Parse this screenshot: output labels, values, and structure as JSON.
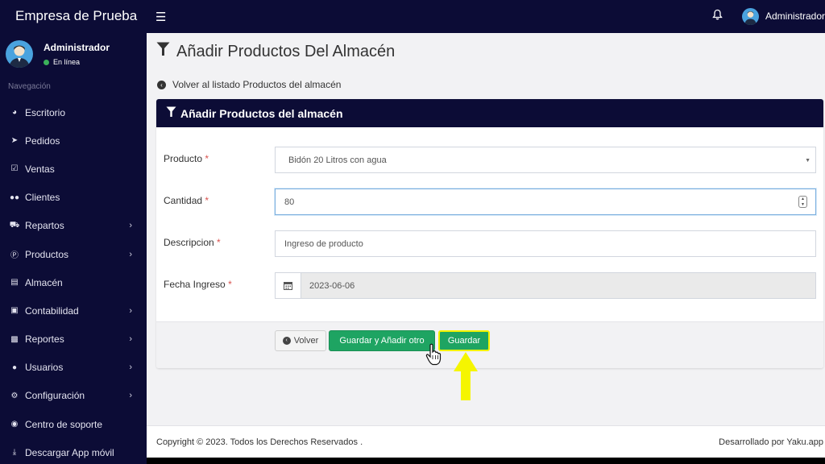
{
  "topbar": {
    "brand": "Empresa de Prueba",
    "user": "Administrador"
  },
  "sidebar": {
    "user_name": "Administrador",
    "status": "En línea",
    "section_header": "Navegación",
    "items": [
      {
        "label": "Escritorio",
        "icon": "dashboard-icon",
        "has_submenu": false
      },
      {
        "label": "Pedidos",
        "icon": "rocket-icon",
        "has_submenu": false
      },
      {
        "label": "Ventas",
        "icon": "check-square-icon",
        "has_submenu": false
      },
      {
        "label": "Clientes",
        "icon": "users-icon",
        "has_submenu": false
      },
      {
        "label": "Repartos",
        "icon": "truck-icon",
        "has_submenu": true
      },
      {
        "label": "Productos",
        "icon": "product-p-icon",
        "has_submenu": true
      },
      {
        "label": "Almacén",
        "icon": "document-icon",
        "has_submenu": false
      },
      {
        "label": "Contabilidad",
        "icon": "money-icon",
        "has_submenu": true
      },
      {
        "label": "Reportes",
        "icon": "bar-chart-icon",
        "has_submenu": true
      },
      {
        "label": "Usuarios",
        "icon": "user-icon",
        "has_submenu": true
      },
      {
        "label": "Configuración",
        "icon": "cogs-icon",
        "has_submenu": true
      },
      {
        "label": "Centro de soporte",
        "icon": "life-ring-icon",
        "has_submenu": false
      },
      {
        "label": "Descargar App móvil",
        "icon": "download-icon",
        "has_submenu": false
      }
    ]
  },
  "page": {
    "title": "Añadir Productos Del Almacén",
    "back_link": "Volver al listado Productos del almacén"
  },
  "form": {
    "header": "Añadir Productos del almacén",
    "fields": {
      "producto": {
        "label": "Producto",
        "required_mark": "*",
        "value": "Bidón 20 Litros con agua"
      },
      "cantidad": {
        "label": "Cantidad",
        "required_mark": "*",
        "value": "80"
      },
      "descripcion": {
        "label": "Descripcion",
        "required_mark": "*",
        "value": "Ingreso de producto"
      },
      "fecha": {
        "label": "Fecha Ingreso",
        "required_mark": "*",
        "value": "2023-06-06"
      }
    },
    "buttons": {
      "volver": "Volver",
      "guardar_otro": "Guardar y Añadir otro",
      "guardar": "Guardar"
    }
  },
  "footer": {
    "copyright": "Copyright © 2023. Todos los Derechos Reservados .",
    "credit": "Desarrollado por Yaku.app"
  },
  "colors": {
    "navy": "#0c0c36",
    "green": "#1ea462",
    "highlight_yellow": "#f2f200",
    "status_green": "#3bb15a"
  }
}
